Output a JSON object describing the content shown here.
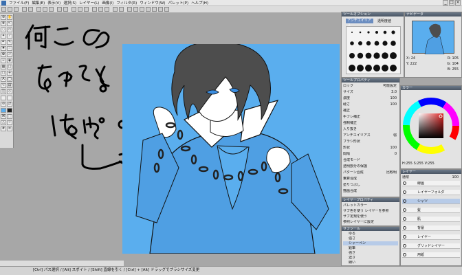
{
  "menu": [
    "ファイル(F)",
    "編集(E)",
    "表示(V)",
    "選択(S)",
    "レイヤー(L)",
    "画像(I)",
    "フィルタ(R)",
    "ウィンドウ(W)",
    "パレット(P)",
    "ヘルプ(H)"
  ],
  "window_buttons": [
    "_",
    "□",
    "×"
  ],
  "handwritten": {
    "line1": "何このの",
    "line2": "ちゅうと",
    "line3": "はんぱ。"
  },
  "panels": {
    "tool_options": {
      "title": "ツールオプション",
      "aa_label": "アンチエイリアス",
      "opacity_label": "透明度値"
    },
    "navigator": {
      "title": "ナビゲータ"
    },
    "color": {
      "title": "カラー",
      "r": "R: 105",
      "g": "G: 104",
      "b": "B: 255",
      "x": "X: 24",
      "y": "Y: 222"
    },
    "tool_props": {
      "title": "ツールプロパティ",
      "rows": [
        {
          "label": "ロック",
          "value": "可能設定"
        },
        {
          "label": "サイズ",
          "value": "3.0"
        },
        {
          "label": "濃度",
          "value": "100"
        },
        {
          "label": "硬さ",
          "value": "100"
        },
        {
          "label": "補正",
          "value": ""
        },
        {
          "label": "手ブレ補正",
          "value": ""
        },
        {
          "label": "強制補正",
          "value": ""
        },
        {
          "label": "入り抜き",
          "value": ""
        },
        {
          "label": "アンチエイリアス",
          "value": "弱"
        },
        {
          "label": "ブラシ形状",
          "value": ""
        },
        {
          "label": "形状",
          "value": "100"
        },
        {
          "label": "間隔",
          "value": "0"
        },
        {
          "label": "合成モード",
          "value": ""
        },
        {
          "label": "透明部分の保護",
          "value": ""
        },
        {
          "label": "パターン合成",
          "value": "比較明"
        },
        {
          "label": "乗算合成",
          "value": ""
        },
        {
          "label": "塗りつぶし",
          "value": ""
        },
        {
          "label": "描画合成",
          "value": ""
        }
      ]
    },
    "layer_props": {
      "title": "レイヤープロパティ",
      "rows": [
        "パレットカラー",
        "サブ色を使う レイヤーを参照",
        "サブ定規を使う",
        "参照レイヤーに設定"
      ]
    },
    "sub_tool": {
      "title": "サブツール",
      "items": [
        "ゆる",
        "強さ",
        "シャーペン",
        "鉛筆",
        "強さ",
        "濃さ",
        "細い"
      ]
    },
    "layers": {
      "title": "レイヤー",
      "mode": "通常",
      "opacity": "100",
      "items": [
        "線画",
        "レイヤーフォルダ",
        "シャツ",
        "髪",
        "肌",
        "背景",
        "レイヤー",
        "グリッドレイヤー",
        "用紙"
      ]
    },
    "color_status": "H:255 S:255 V:255"
  },
  "status_text": "[Ctrl] パス選択 / [Alt] スポイト / [Shift] 直線を引く / [Ctrl] + [Alt] ドラッグでブラシサイズ変更",
  "colors": {
    "canvas_bg": "#5aaeee",
    "shirt": "#4f9fe3",
    "panel_title": "#4a5563"
  }
}
